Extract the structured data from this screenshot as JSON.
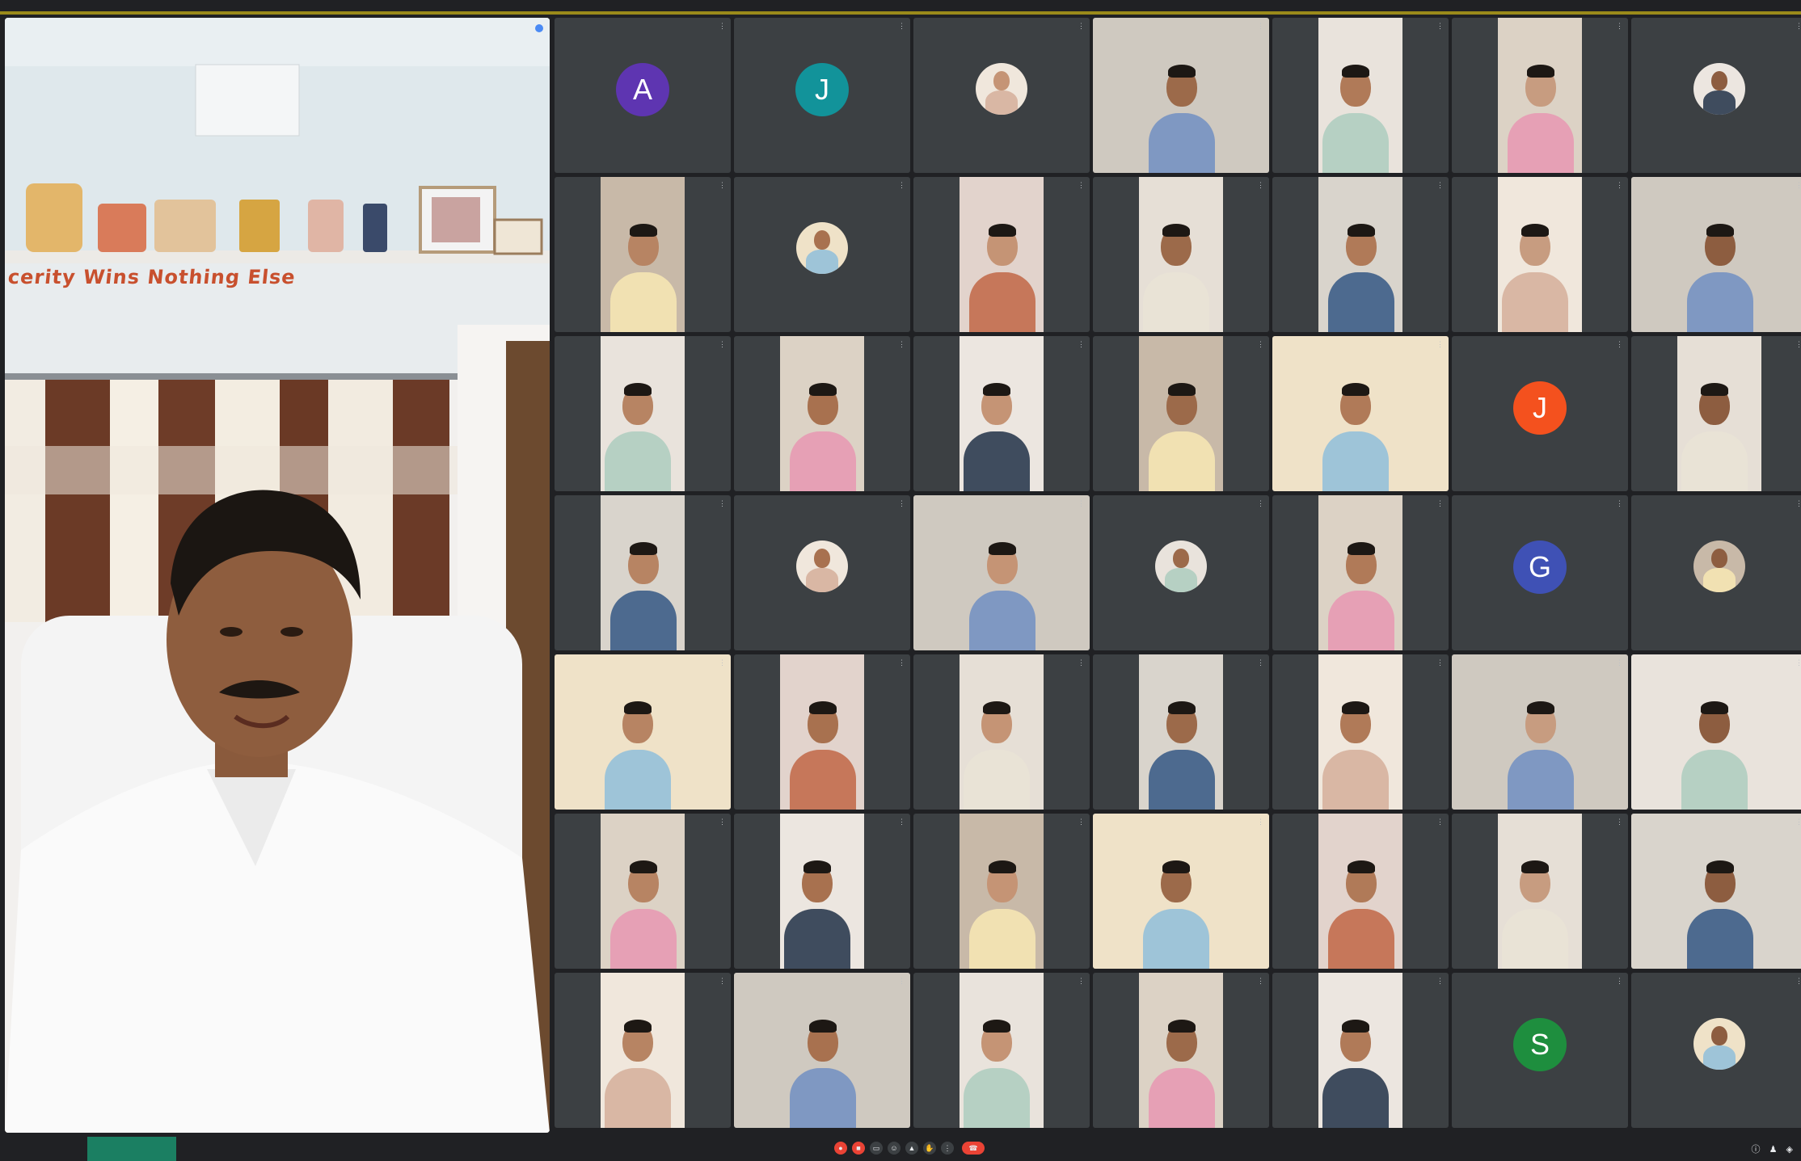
{
  "main_speaker": {
    "wall_text": "cerity Wins Nothing Else"
  },
  "bottom_bar": {
    "time_code": "",
    "caption_lines": [
      "",
      "",
      ""
    ]
  },
  "controls": {
    "mic_icon": "mic-icon",
    "camera_icon": "camera-icon",
    "captions_icon": "captions-icon",
    "emoji_icon": "emoji-icon",
    "present_icon": "present-icon",
    "raise_hand_icon": "raise-hand-icon",
    "more_icon": "more-options-icon",
    "end_call_icon": "end-call-icon"
  },
  "participants": [
    {
      "avatar": "A",
      "color": "#5e35b1"
    },
    {
      "avatar": "J",
      "color": "#12939a"
    },
    {
      "avatar_photo": true
    },
    {
      "photo": true
    },
    {
      "photo": true
    },
    {
      "photo": true
    },
    {
      "avatar_photo": true
    },
    {
      "photo": true
    },
    {
      "avatar_photo": true
    },
    {
      "photo": true
    },
    {
      "photo": true
    },
    {
      "photo": true
    },
    {
      "photo": true
    },
    {
      "photo": true
    },
    {
      "photo": true
    },
    {
      "photo": true
    },
    {
      "photo": true
    },
    {
      "photo": true
    },
    {
      "photo": true
    },
    {
      "avatar": "J",
      "color": "#f4511e"
    },
    {
      "photo": true
    },
    {
      "photo": true
    },
    {
      "avatar_photo": true
    },
    {
      "photo": true
    },
    {
      "avatar_photo": true
    },
    {
      "photo": true
    },
    {
      "avatar": "G",
      "color": "#3f51b5"
    },
    {
      "avatar_photo": true
    },
    {
      "photo": true
    },
    {
      "photo": true
    },
    {
      "photo": true
    },
    {
      "photo": true
    },
    {
      "photo": true
    },
    {
      "photo": true
    },
    {
      "photo": true
    },
    {
      "photo": true
    },
    {
      "photo": true
    },
    {
      "photo": true
    },
    {
      "photo": true
    },
    {
      "photo": true
    },
    {
      "photo": true
    },
    {
      "photo": true
    },
    {
      "photo": true
    },
    {
      "photo": true
    },
    {
      "photo": true
    },
    {
      "photo": true
    },
    {
      "photo": true
    },
    {
      "avatar": "S",
      "color": "#1e8e3e"
    },
    {
      "avatar_photo": true
    }
  ]
}
